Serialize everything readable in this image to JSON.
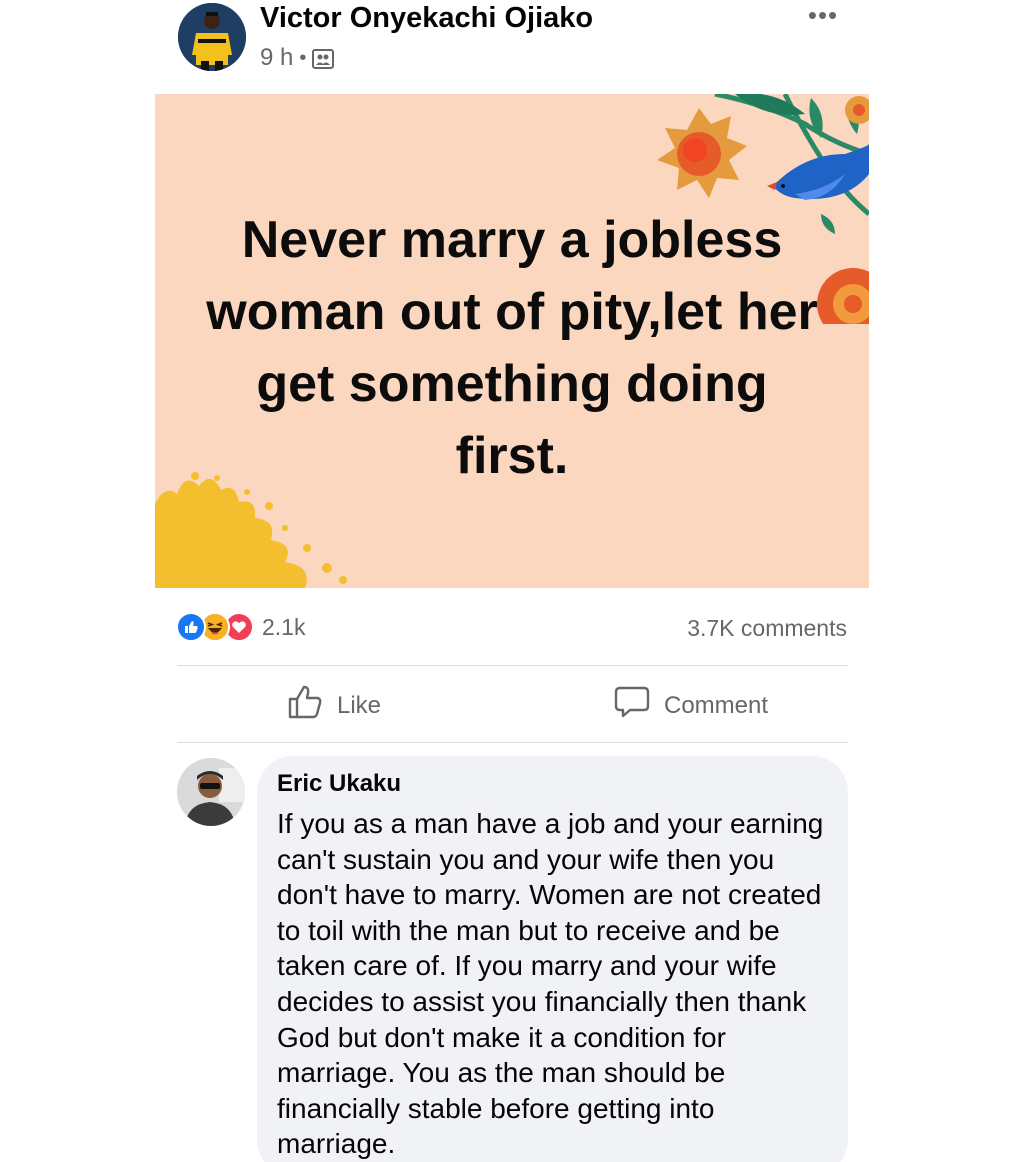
{
  "post": {
    "author": "Victor Onyekachi Ojiako",
    "time": "9 h",
    "separator": "•",
    "audience_icon": "group-icon",
    "more_icon": "more-options-icon",
    "more_label": "•••",
    "image_text": "Never marry a jobless woman out of pity,let her get something doing first.",
    "image_background": "#fbd7bf"
  },
  "stats": {
    "reaction_icons": [
      "like-reaction-icon",
      "haha-reaction-icon",
      "love-reaction-icon"
    ],
    "reactions_count": "2.1k",
    "comments_count": "3.7K comments"
  },
  "actions": {
    "like_label": "Like",
    "comment_label": "Comment"
  },
  "comment": {
    "author": "Eric Ukaku",
    "text": "If you as a man have a job and your earning can't sustain you and your wife then you don't have to marry. Women are not created to toil with the man but to receive and be taken care of. If you marry and your wife decides to assist you financially then thank God but don't make it a condition for marriage. You as the man should be financially stable before getting into marriage."
  },
  "colors": {
    "like_blue": "#1877f2",
    "love_red": "#f33e58",
    "haha_yellow": "#f7b125",
    "secondary_text": "#65676b",
    "comment_bubble": "#f0f2f5"
  }
}
